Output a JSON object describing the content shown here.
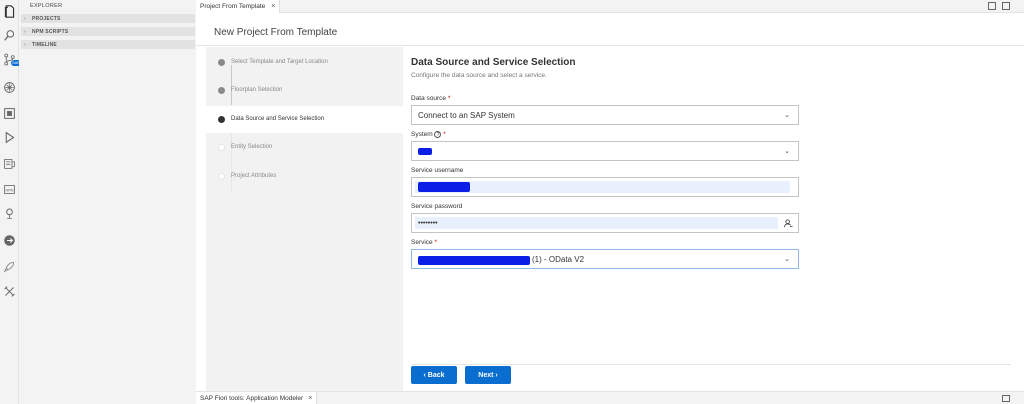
{
  "explorer": {
    "title": "EXPLORER",
    "sections": [
      "PROJECTS",
      "NPM SCRIPTS",
      "TIMELINE"
    ]
  },
  "activity_bar": {
    "icons": [
      "files-icon",
      "search-icon",
      "source-control-icon",
      "debug-icon",
      "extensions-icon",
      "run-icon",
      "storyboard-icon",
      "npm-icon",
      "service-center-icon",
      "deploy-icon",
      "rocket-icon",
      "tools-icon"
    ],
    "badge": "SAP"
  },
  "editor_tab": {
    "label": "Project From Template",
    "close": "×"
  },
  "page": {
    "title": "New Project From Template"
  },
  "steps": [
    {
      "label": "Select Template and Target Location",
      "state": "done"
    },
    {
      "label": "Floorplan Selection",
      "state": "done"
    },
    {
      "label": "Data Source and Service Selection",
      "state": "current"
    },
    {
      "label": "Entity Selection",
      "state": "todo"
    },
    {
      "label": "Project Attributes",
      "state": "todo"
    }
  ],
  "form": {
    "title": "Data Source and Service Selection",
    "subtitle": "Configure the data source and select a service.",
    "data_source": {
      "label": "Data source",
      "required": "*",
      "value": "Connect to an SAP System"
    },
    "system": {
      "label": "System",
      "help": "?",
      "required": "*"
    },
    "username": {
      "label": "Service username"
    },
    "password": {
      "label": "Service password",
      "value": "••••••••"
    },
    "service": {
      "label": "Service",
      "required": "*",
      "value": "(1) - OData V2"
    }
  },
  "buttons": {
    "back": "‹  Back",
    "next": "Next  ›"
  },
  "panel": {
    "tab_label": "SAP Fiori tools: Application Modeler",
    "close": "×"
  },
  "colors": {
    "accent": "#0a6ed1",
    "required": "#bb0000",
    "redaction": "#0b1ee6"
  }
}
